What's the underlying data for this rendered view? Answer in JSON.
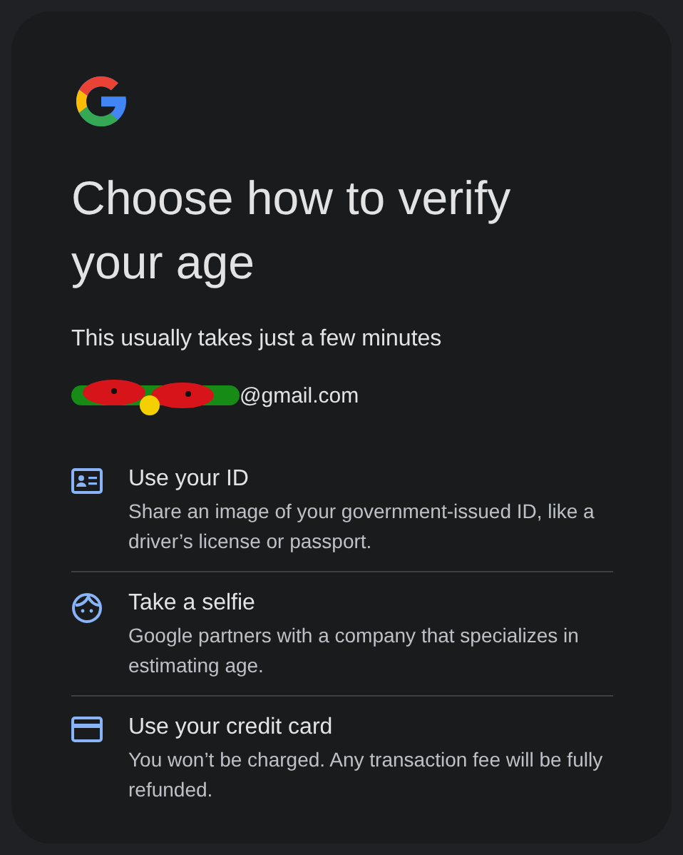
{
  "title": "Choose how to verify your age",
  "subtitle": "This usually takes just a few minutes",
  "account": {
    "email": "@gmail.com"
  },
  "options": [
    {
      "kind": "id",
      "title": "Use your ID",
      "description": "Share an image of your government-issued ID, like a driver’s license or passport."
    },
    {
      "kind": "selfie",
      "title": "Take a selfie",
      "description": "Google partners with a company that specializes in estimating age."
    },
    {
      "kind": "card",
      "title": "Use your credit card",
      "description": "You won’t be charged. Any transaction fee will be fully refunded."
    }
  ]
}
